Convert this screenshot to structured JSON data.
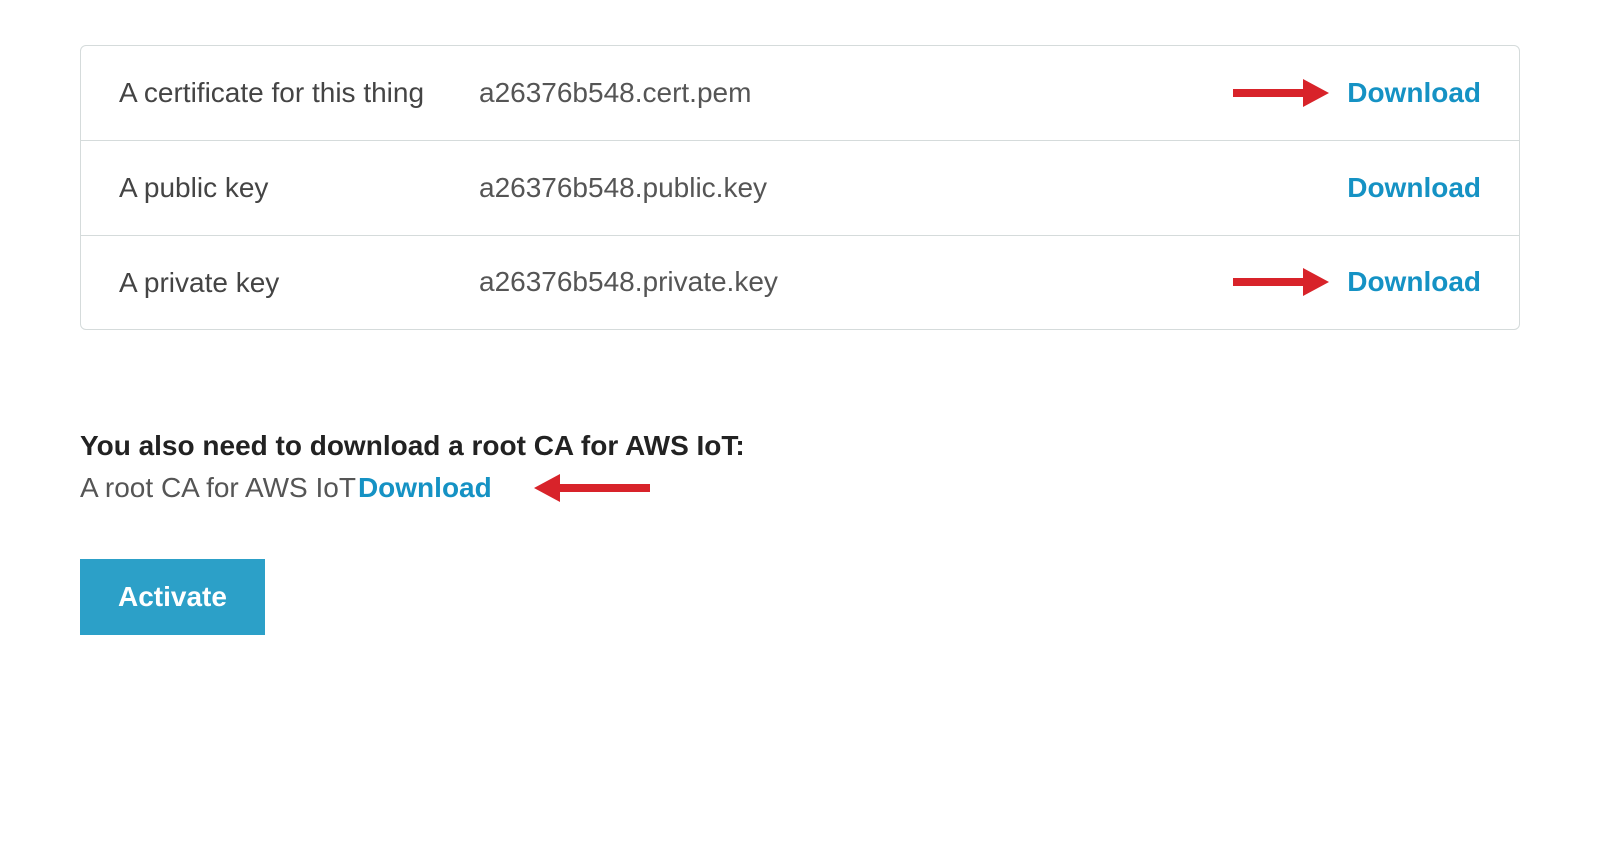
{
  "table": {
    "rows": [
      {
        "label": "A certificate for this thing",
        "filename": "a26376b548.cert.pem",
        "download": "Download",
        "arrow": true
      },
      {
        "label": "A public key",
        "filename": "a26376b548.public.key",
        "download": "Download",
        "arrow": false
      },
      {
        "label": "A private key",
        "filename": "a26376b548.private.key",
        "download": "Download",
        "arrow": true
      }
    ]
  },
  "rootCa": {
    "heading": "You also need to download a root CA for AWS IoT:",
    "text": "A root CA for AWS IoT",
    "download": "Download"
  },
  "activate": {
    "label": "Activate"
  }
}
